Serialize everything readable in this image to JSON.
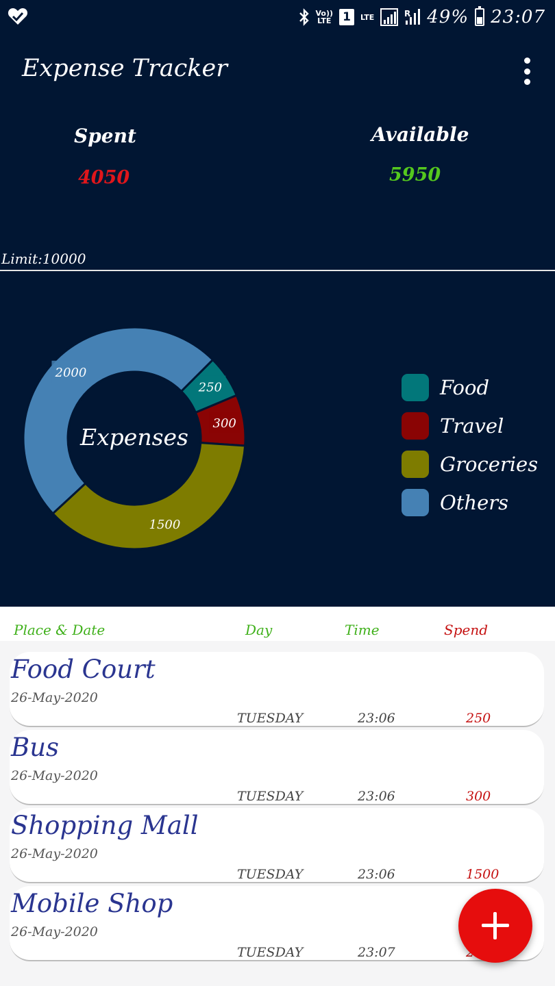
{
  "status_bar": {
    "battery": "49%",
    "time": "23:07",
    "sim": "1",
    "volte_top": "Vo))",
    "volte_bottom": "LTE",
    "lte": "LTE",
    "roaming": "R"
  },
  "app_bar": {
    "title": "Expense Tracker"
  },
  "summary": {
    "spent_label": "Spent",
    "spent_value": "4050",
    "available_label": "Available",
    "available_value": "5950",
    "limit_text": "Limit:10000",
    "spent_color": "#e0161b",
    "available_color": "#55c81e"
  },
  "chart_data": {
    "type": "pie",
    "center_label": "Expenses",
    "categories": [
      "Food",
      "Travel",
      "Groceries",
      "Others"
    ],
    "values": [
      250,
      300,
      1500,
      2000
    ],
    "colors": [
      "#02777a",
      "#8a0404",
      "#7e7c00",
      "#4581b4"
    ]
  },
  "list_header": {
    "place_date": "Place & Date",
    "day": "Day",
    "time": "Time",
    "spend": "Spend"
  },
  "expenses": [
    {
      "place": "Food Court",
      "date": "26-May-2020",
      "day": "TUESDAY",
      "time": "23:06",
      "amount": "250"
    },
    {
      "place": "Bus",
      "date": "26-May-2020",
      "day": "TUESDAY",
      "time": "23:06",
      "amount": "300"
    },
    {
      "place": "Shopping Mall",
      "date": "26-May-2020",
      "day": "TUESDAY",
      "time": "23:06",
      "amount": "1500"
    },
    {
      "place": "Mobile Shop",
      "date": "26-May-2020",
      "day": "TUESDAY",
      "time": "23:07",
      "amount": "2000"
    }
  ],
  "theme": {
    "primary_dark": "#011633",
    "accent": "#e60d0d",
    "header_green": "#3fb01a",
    "header_red": "#c51111"
  }
}
